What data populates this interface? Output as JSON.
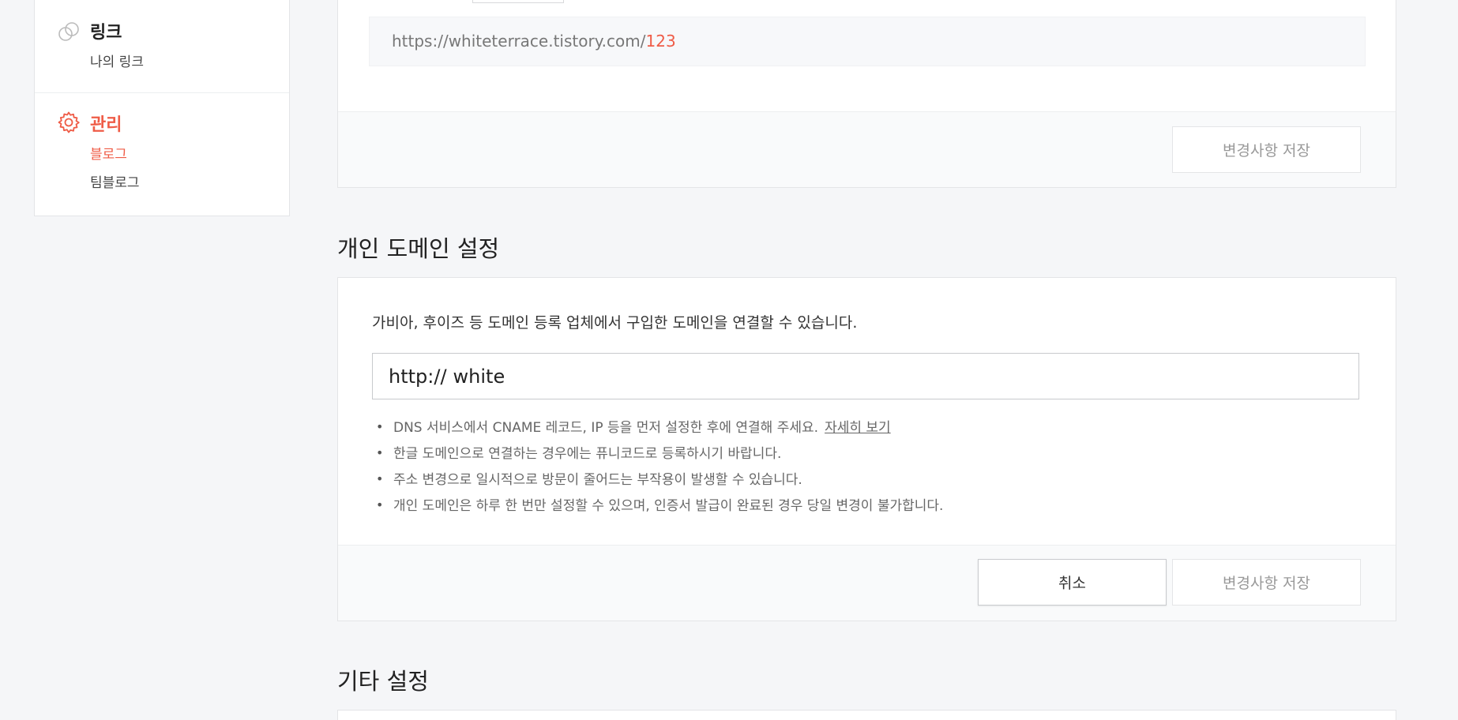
{
  "sidebar": {
    "link_group": {
      "title": "링크",
      "items": [
        {
          "label": "나의 링크"
        }
      ]
    },
    "manage_group": {
      "title": "관리",
      "items": [
        {
          "label": "블로그",
          "active": true
        },
        {
          "label": "팀블로그"
        }
      ]
    },
    "accent_color": "#ef5c47"
  },
  "url_section": {
    "url_base": "https://whiteterrace.tistory.com/",
    "url_suffix": "123",
    "save_label": "변경사항 저장"
  },
  "domain_section": {
    "title": "개인 도메인 설정",
    "description": "가비아, 후이즈 등 도메인 등록 업체에서 구입한 도메인을 연결할 수 있습니다.",
    "input_prefix": "http://",
    "input_value": "white",
    "notes": [
      {
        "text": "DNS 서비스에서 CNAME 레코드, IP 등을 먼저 설정한 후에 연결해 주세요.",
        "link": "자세히 보기"
      },
      {
        "text": "한글 도메인으로 연결하는 경우에는 퓨니코드로 등록하시기 바랍니다."
      },
      {
        "text": "주소 변경으로 일시적으로 방문이 줄어드는 부작용이 발생할 수 있습니다."
      },
      {
        "text": "개인 도메인은 하루 한 번만 설정할 수 있으며, 인증서 발급이 완료된 경우 당일 변경이 불가합니다."
      }
    ],
    "cancel_label": "취소",
    "save_label": "변경사항 저장"
  },
  "etc_section": {
    "title": "기타 설정"
  }
}
